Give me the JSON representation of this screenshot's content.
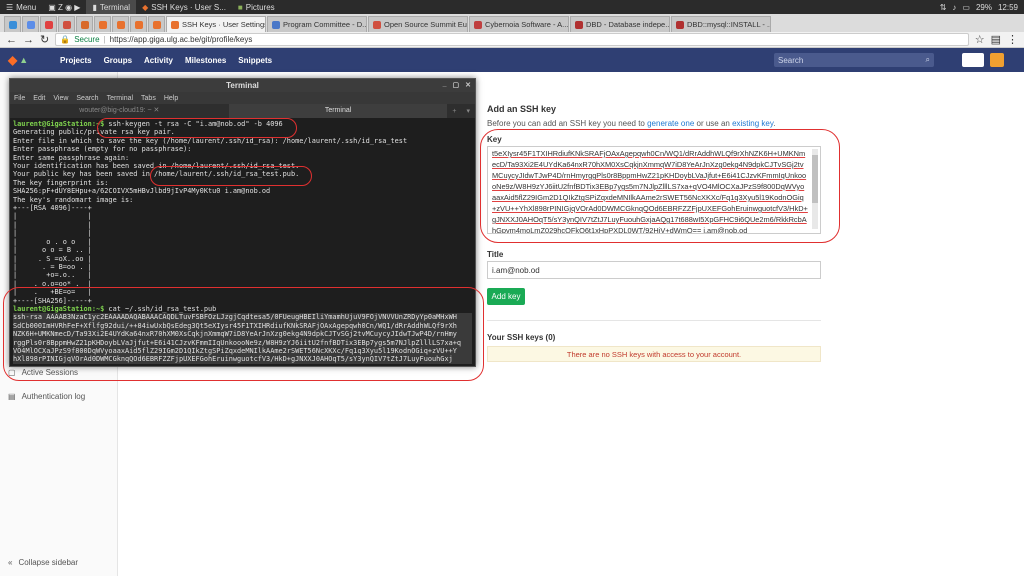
{
  "os_panel": {
    "menu_label": "Menu",
    "apps": [
      {
        "label": "Terminal",
        "active": true
      },
      {
        "label": "SSH Keys · User S...",
        "active": false
      },
      {
        "label": "Pictures",
        "active": false
      }
    ],
    "battery": "29%",
    "clock": "12:59"
  },
  "browser": {
    "tabs": [
      {
        "label": "SSH Keys · User Settings",
        "active": true
      },
      {
        "label": "Program Committee - D...",
        "active": false
      },
      {
        "label": "Open Source Summit Eu...",
        "active": false
      },
      {
        "label": "Cybernoia Software - A...",
        "active": false
      },
      {
        "label": "DBD - Database indepe...",
        "active": false
      },
      {
        "label": "DBD::mysql::INSTALL - ...",
        "active": false
      }
    ],
    "secure_label": "Secure",
    "url": "https://app.giga.ulg.ac.be/git/profile/keys"
  },
  "gitlab_nav": {
    "menu": [
      "Projects",
      "Groups",
      "Activity",
      "Milestones",
      "Snippets"
    ],
    "search_placeholder": "Search"
  },
  "sidebar": {
    "items": [
      "Active Sessions",
      "Authentication log"
    ],
    "collapse_label": "Collapse sidebar"
  },
  "form": {
    "heading": "Add an SSH key",
    "intro_before": "Before you can add an SSH key you need to ",
    "intro_link1": "generate one",
    "intro_mid": " or use an ",
    "intro_link2": "existing key",
    "intro_after": ".",
    "key_label": "Key",
    "key_value": "t5eXIysr45F1TXIHRdiufKNkSRAFjOAxAgepqwh0Cn/WQ1/dRrAddhWLQf9rXhNZK6H+UMKNmecD/Ta93Xi2E4UYdKa64nxR70hXM0XsCqkjnXmmqW7iD8YeArJnXzg0ekg4N9dpkCJTvSGj2tvMCuycyJIdwTJwP4D/rnHmyrggPls0r8BppmHwZ21pKHDoybLVaJjfut+E6i41CJzvKFmmIqUnkoooNe9z/W8H9zYJ6iitU2fnfBDTix3EBp7ygs5m7NJlpZlllLS7xa+qVO4MlOCXaJPzS9f800DqWVyoaaxAid5flZ29IGm2D1QIkZtgSPiZqxdeMNIlkAAme2rSWET56NcXKXc/Fq1q3Xyu5l19KodnOGiq+zVU++YhXl898rPINIGjqVOrAd0DWMCGknqQOd6EBRFZZFjpUXEFGohEruinwguotcfV3/HkD+gJNXXJ0AHOqT5/sY3ynQIV7tZtJ7LuyFuouhGxjaAQg17t688wI5XpGFHC9i6QUe2m6/RkkRcbAhGpvm4moLmZ029hcQFkQ6t1xHpPXDL0WT/92HjV+dWmQ== i.am@nob.od",
    "title_label": "Title",
    "title_value": "i.am@nob.od",
    "add_button": "Add key",
    "your_keys_heading": "Your SSH keys (0)",
    "no_keys_msg": "There are no SSH keys with access to your account."
  },
  "terminal": {
    "title": "Terminal",
    "menu": [
      "File",
      "Edit",
      "View",
      "Search",
      "Terminal",
      "Tabs",
      "Help"
    ],
    "tabs": [
      "wouter@big-cloud19: ~",
      "Terminal"
    ],
    "lines": [
      {
        "p": "laurent@GigaStation:~$",
        "t": " ssh-keygen -t rsa -C \"i.am@nob.od\" -b 4096"
      },
      {
        "t": "Generating public/private rsa key pair."
      },
      {
        "t": "Enter file in which to save the key (/home/laurent/.ssh/id_rsa): /home/laurent/.ssh/id_rsa_test"
      },
      {
        "t": "Enter passphrase (empty for no passphrase):"
      },
      {
        "t": "Enter same passphrase again:"
      },
      {
        "t": "Your identification has been saved in /home/laurent/.ssh/id_rsa_test."
      },
      {
        "t": "Your public key has been saved in /home/laurent/.ssh/id_rsa_test.pub."
      },
      {
        "t": "The key fingerprint is:"
      },
      {
        "t": "SHA256:pF+dUY8EHpu+a/62COIVX5mHBvJlbd9jIvP4My0Ktu0 i.am@nob.od"
      },
      {
        "t": "The key's randomart image is:"
      },
      {
        "t": "+---[RSA 4096]----+"
      },
      {
        "t": "|                 |"
      },
      {
        "t": "|                 |"
      },
      {
        "t": "|                 |"
      },
      {
        "t": "|       o . o o   |"
      },
      {
        "t": "|      o o = B .. |"
      },
      {
        "t": "|     . S =oX..oo |"
      },
      {
        "t": "|      . = B=oo . |"
      },
      {
        "t": "|       +o=.o..   |"
      },
      {
        "t": "|    . o.o=oo* .  |"
      },
      {
        "t": "|    .   +BE=o=   |"
      },
      {
        "t": "+----[SHA256]-----+"
      },
      {
        "p": "laurent@GigaStation:~$",
        "t": " cat ~/.ssh/id_rsa_test.pub"
      },
      {
        "t": "ssh-rsa AAAAB3NzaC1yc2EAAAADAQABAAACAQDLTuvFSBFOzLJzgjCqdtesa5/0FUeugHBEIliYmamhUjuV9FOjVNVVUnZRDyYp0aMHxWH"
      },
      {
        "t": "SdCb000ImHVRhFeF+Xflfg92dui/++84iwUxbQsEdeg3Qt5eXIysr45F1TXIHRdiufKNkSRAFjOAxAgepqwh0Cn/WQ1/dRrAddhWLQf9rXh"
      },
      {
        "t": "NZK6H+UMKNmecD/Ta93Xi2E4UYdKa64nxR70hXM0XsCqkjnXmmqW7iD8YeArJnXzg0ekg4N9dpkCJTvSGj2tvMCuycyJIdwTJwP4D/rnHmy"
      },
      {
        "t": "rggPls0r8BppmHwZ21pKHDoybLVaJjfut+E6i41CJzvKFmmIIqUnkoooNe9z/W8H9zYJ6iitU2fnfBDTix3EBp7ygs5m7NJlpZlllLS7xa+q"
      },
      {
        "t": "VO4MlOCXaJPzS9f800DqWVyoaaxAid5flZ29IGm2D1QIkZtgSPiZqxdeMNIlkAAme2rSWET56NcXKXc/Fq1q3Xyu5l19KodnOGiq+zVU++Y"
      },
      {
        "t": "hXl898rPINIGjqVOrAd0DWMCGknqQOd6EBRFZZFjpUXEFGohEruinwguotcfV3/HkD+gJNXXJ0AHOqT5/sY3ynQIV7tZtJ7LuyFuouhGxj"
      },
      {
        "t": "aAQg17t688wI5XpGFHC9i6QUe2m6/RkkRcbAhGpvm4moLmZ029hcQFkQ6t1xHpPXDL0WT/92HjV+dWmQ== i.am@nob.od"
      },
      {
        "p": "laurent@GigaStation:~$",
        "t": " ",
        "cursor": true
      }
    ]
  },
  "colors": {
    "nav_bg": "#2f3f73",
    "accent_red": "#e03030",
    "button_green": "#1aaa55",
    "prompt_green": "#7fd34e"
  }
}
